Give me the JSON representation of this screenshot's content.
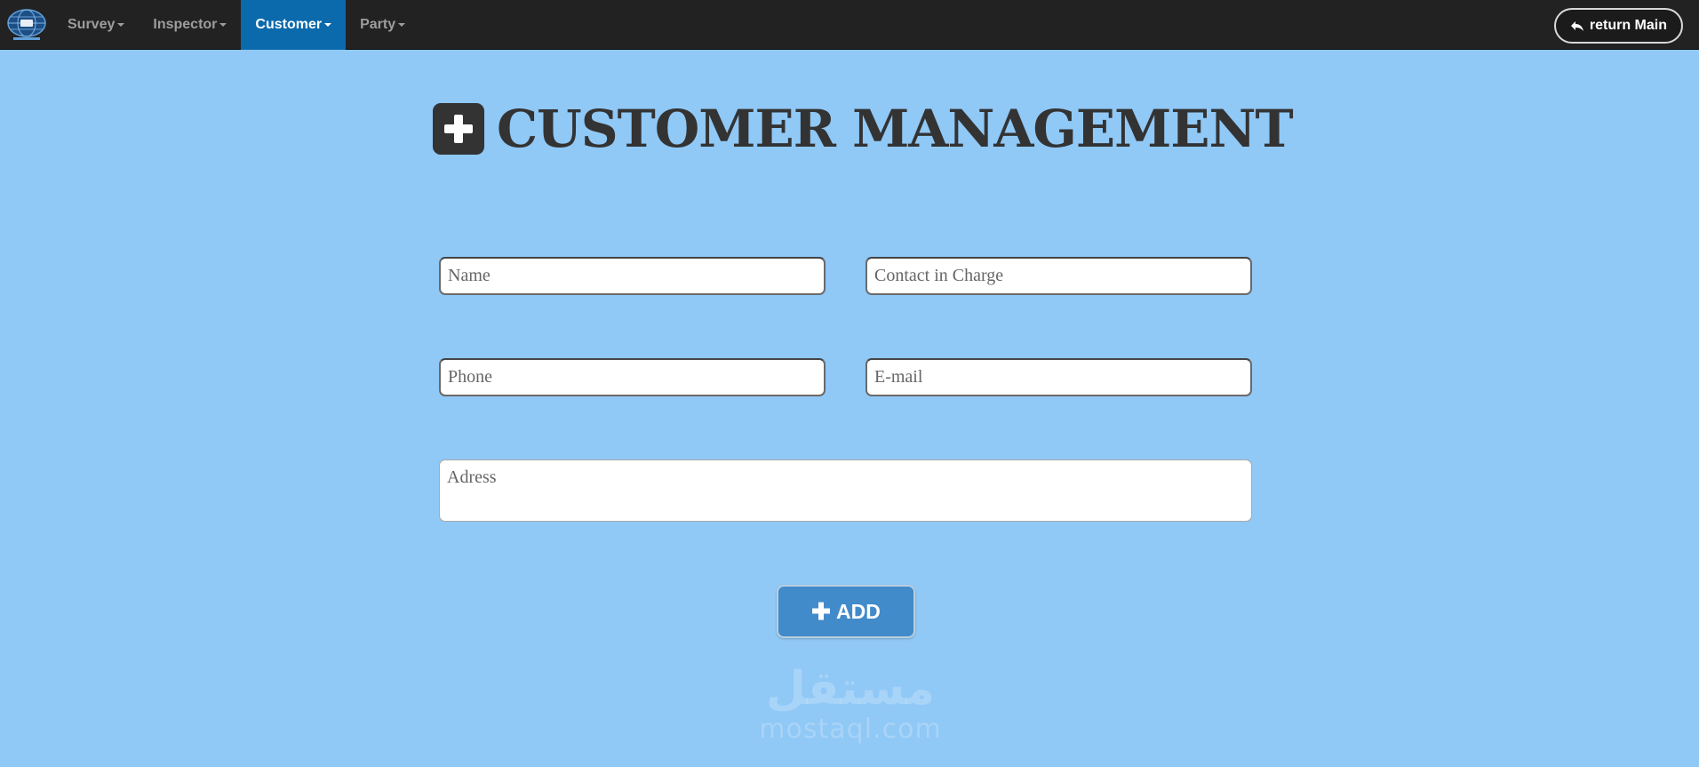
{
  "navbar": {
    "items": [
      {
        "label": "Survey"
      },
      {
        "label": "Inspector"
      },
      {
        "label": "Customer"
      },
      {
        "label": "Party"
      }
    ],
    "active_index": 2,
    "return_label": "return Main"
  },
  "page": {
    "title": "CUSTOMER MANAGEMENT"
  },
  "form": {
    "name_placeholder": "Name",
    "contact_placeholder": "Contact in Charge",
    "phone_placeholder": "Phone",
    "email_placeholder": "E-mail",
    "address_placeholder": "Adress",
    "add_label": "ADD"
  },
  "watermark": {
    "arabic": "مستقل",
    "latin": "mostaql.com"
  },
  "colors": {
    "background": "#90c8f6",
    "navbar": "#222222",
    "active_nav": "#0a6aac",
    "add_button": "#428bca",
    "title": "#333333"
  },
  "icons": {
    "brand": "globe-logo-icon",
    "return": "reply-arrow-icon",
    "title": "plus-square-icon",
    "add": "plus-icon"
  }
}
